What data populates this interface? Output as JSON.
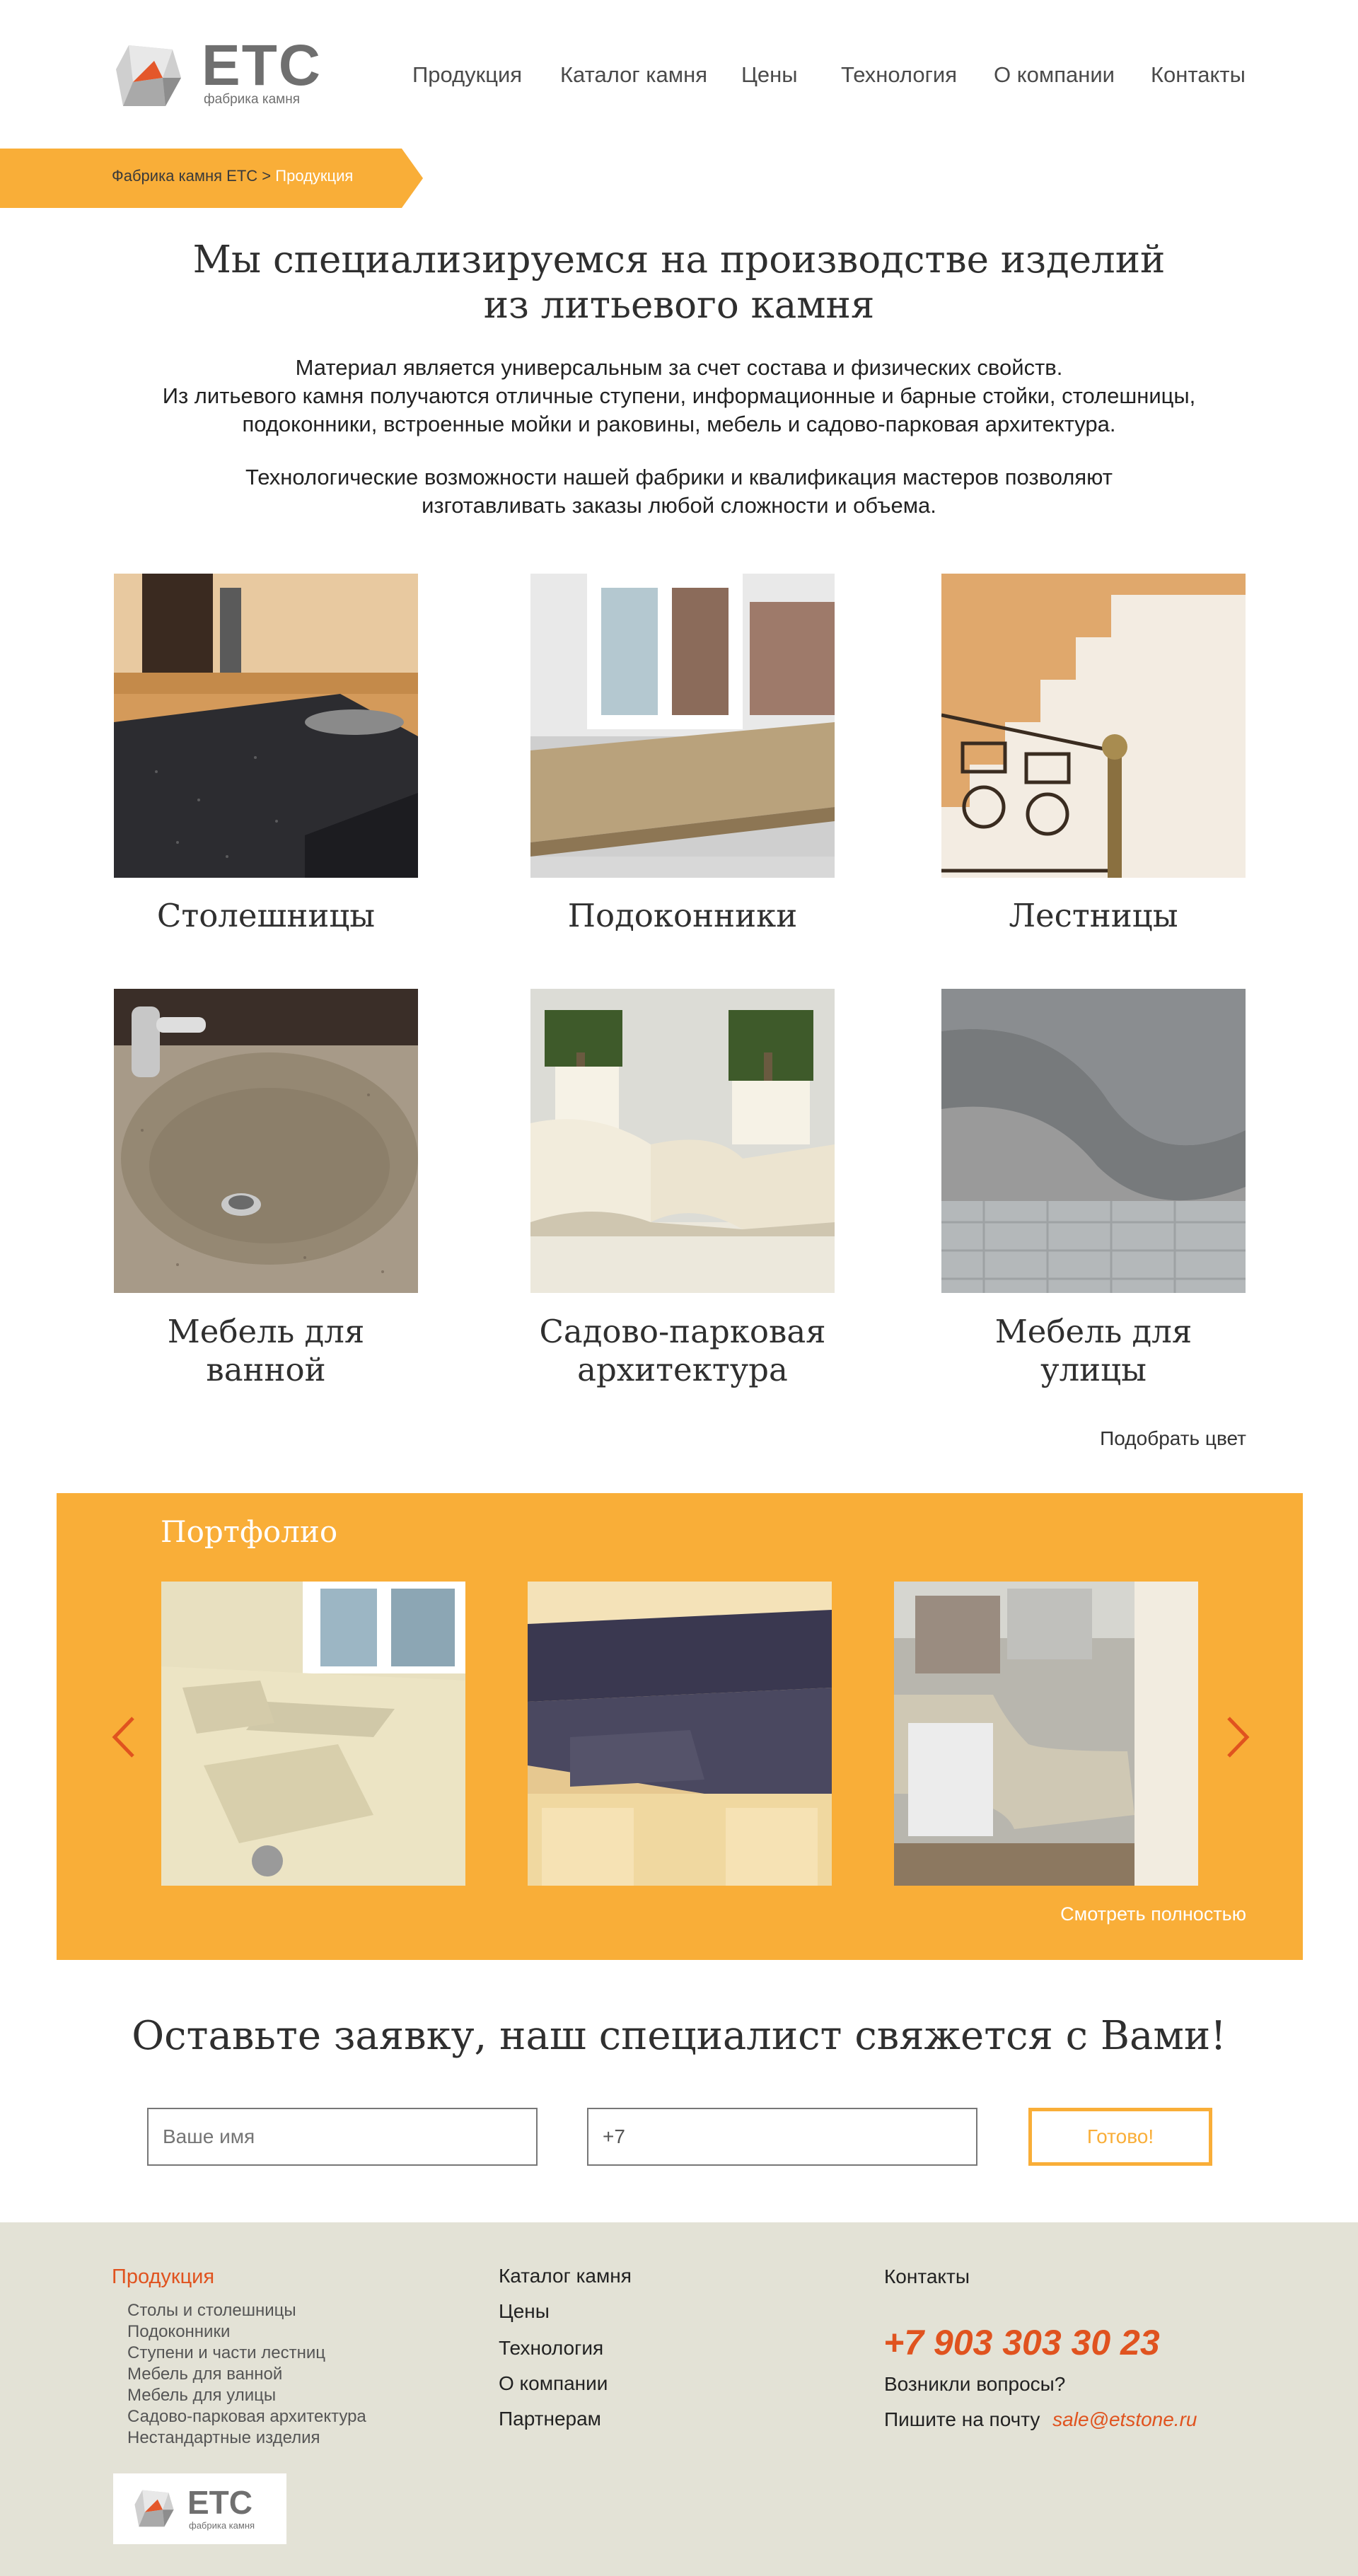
{
  "header": {
    "logo_text": "ЕТС",
    "logo_sub": "фабрика камня",
    "nav": [
      "Продукция",
      "Каталог камня",
      "Цены",
      "Технология",
      "О компании",
      "Контакты"
    ]
  },
  "breadcrumb": {
    "parent": "Фабрика камня ЕТС",
    "separator": " > ",
    "current": "Продукция"
  },
  "intro": {
    "title_line1": "Мы специализируемся на производстве изделий",
    "title_line2": "из литьевого камня",
    "para1_line1": "Материал является универсальным за счет состава и физических свойств.",
    "para1_line2": "Из литьевого камня получаются отличные ступени, информационные и барные стойки, столешницы,",
    "para1_line3": "подоконники, встроенные мойки и раковины, мебель и садово-парковая архитектура.",
    "para2_line1": "Технологические возможности нашей фабрики и квалификация мастеров позволяют",
    "para2_line2": "изготавливать заказы любой сложности и объема."
  },
  "products": [
    {
      "line1": "Столешницы",
      "line2": ""
    },
    {
      "line1": "Подоконники",
      "line2": ""
    },
    {
      "line1": "Лестницы",
      "line2": ""
    },
    {
      "line1": "Мебель для",
      "line2": "ванной"
    },
    {
      "line1": "Садово-парковая",
      "line2": "архитектура"
    },
    {
      "line1": "Мебель для",
      "line2": "улицы"
    }
  ],
  "pick_color": "Подобрать цвет",
  "portfolio": {
    "title": "Портфолио",
    "see_all": "Смотреть полностью"
  },
  "form": {
    "title": "Оставьте заявку, наш специалист свяжется с Вами!",
    "name_placeholder": "Ваше имя",
    "phone_value": "+7",
    "submit": "Готово!"
  },
  "footer": {
    "col1_title": "Продукция",
    "col1_items": [
      "Столы и столешницы",
      "Подоконники",
      "Ступени и части лестниц",
      "Мебель для ванной",
      "Мебель для улицы",
      "Садово-парковая архитектура",
      "Нестандартные изделия"
    ],
    "col2_items": [
      "Каталог камня",
      "Цены",
      "Технология",
      "О компании",
      "Партнерам"
    ],
    "col3_title": "Контакты",
    "phone": "+7 903 303 30 23",
    "questions": "Возникли вопросы?",
    "write_to": "Пишите на почту",
    "email": "sale@etstone.ru"
  },
  "colors": {
    "accent": "#f9ae38",
    "orange_text": "#e0531f",
    "footer_bg": "#e3e2d6"
  }
}
